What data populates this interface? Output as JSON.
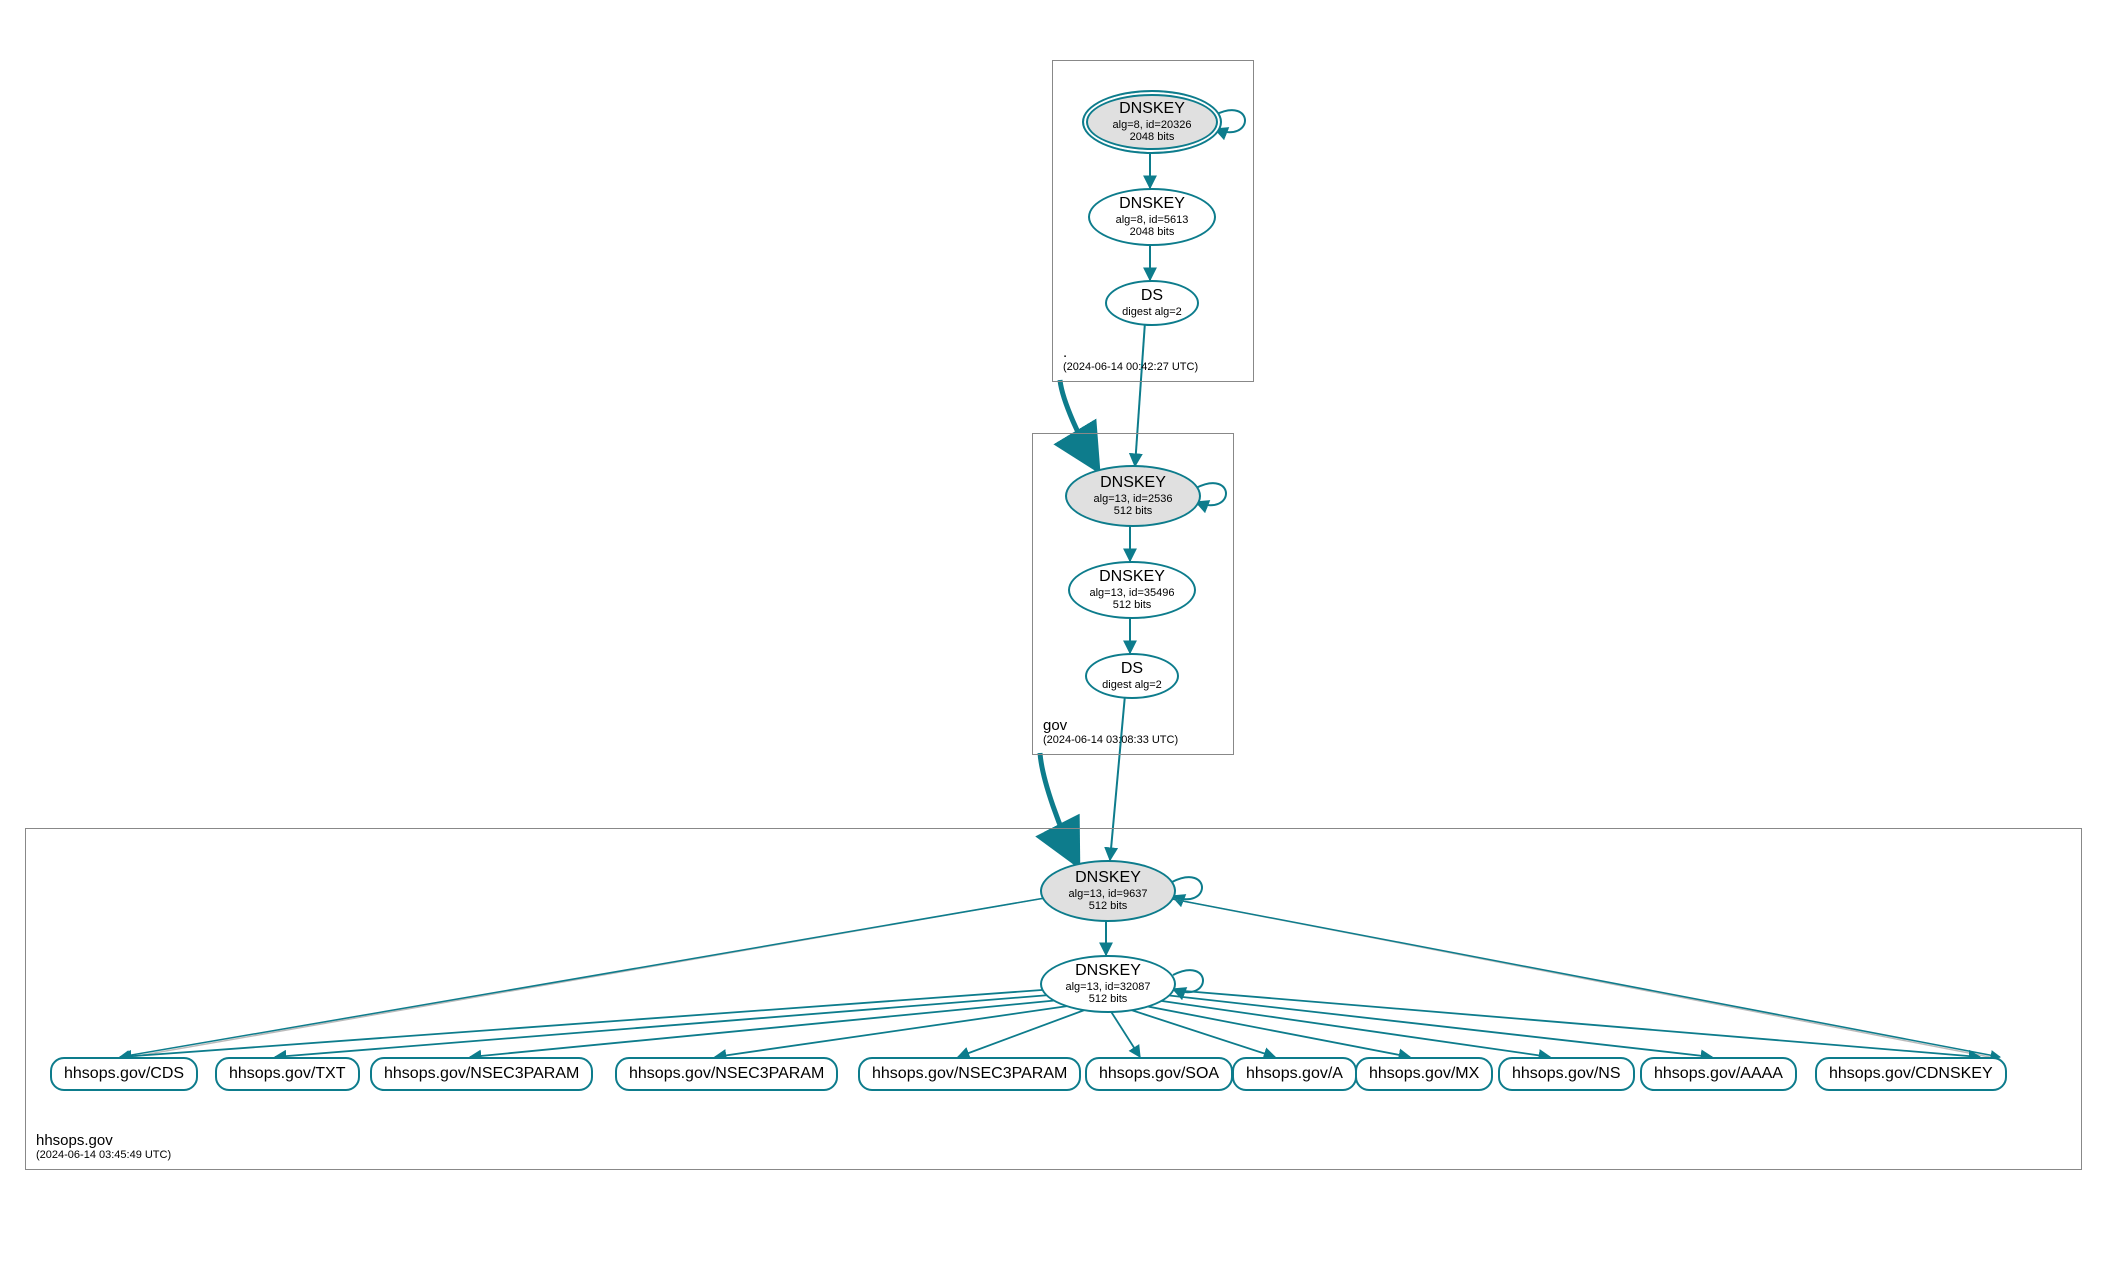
{
  "zones": {
    "root": {
      "label": ".",
      "timestamp": "(2024-06-14 00:42:27 UTC)",
      "dnskey_ksk": {
        "title": "DNSKEY",
        "detail": "alg=8, id=20326",
        "bits": "2048 bits"
      },
      "dnskey_zsk": {
        "title": "DNSKEY",
        "detail": "alg=8, id=5613",
        "bits": "2048 bits"
      },
      "ds": {
        "title": "DS",
        "detail": "digest alg=2"
      }
    },
    "gov": {
      "label": "gov",
      "timestamp": "(2024-06-14 03:08:33 UTC)",
      "dnskey_ksk": {
        "title": "DNSKEY",
        "detail": "alg=13, id=2536",
        "bits": "512 bits"
      },
      "dnskey_zsk": {
        "title": "DNSKEY",
        "detail": "alg=13, id=35496",
        "bits": "512 bits"
      },
      "ds": {
        "title": "DS",
        "detail": "digest alg=2"
      }
    },
    "domain": {
      "label": "hhsops.gov",
      "timestamp": "(2024-06-14 03:45:49 UTC)",
      "dnskey_ksk": {
        "title": "DNSKEY",
        "detail": "alg=13, id=9637",
        "bits": "512 bits"
      },
      "dnskey_zsk": {
        "title": "DNSKEY",
        "detail": "alg=13, id=32087",
        "bits": "512 bits"
      }
    }
  },
  "records": {
    "r0": "hhsops.gov/CDS",
    "r1": "hhsops.gov/TXT",
    "r2": "hhsops.gov/NSEC3PARAM",
    "r3": "hhsops.gov/NSEC3PARAM",
    "r4": "hhsops.gov/NSEC3PARAM",
    "r5": "hhsops.gov/SOA",
    "r6": "hhsops.gov/A",
    "r7": "hhsops.gov/MX",
    "r8": "hhsops.gov/NS",
    "r9": "hhsops.gov/AAAA",
    "r10": "hhsops.gov/CDNSKEY"
  }
}
